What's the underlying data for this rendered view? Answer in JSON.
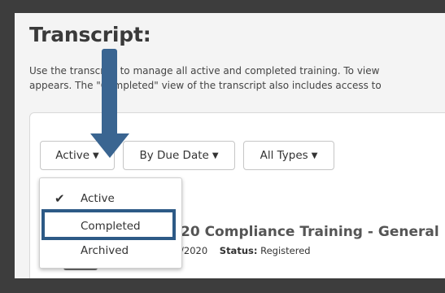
{
  "header": {
    "title": "Transcript:",
    "description_line1": "Use the transcript to manage all active and completed training. To view",
    "description_line2": "appears. The \"Completed\" view of the transcript also includes access to"
  },
  "filters": {
    "status_label": "Active",
    "sort_label": "By Due Date",
    "type_label": "All Types"
  },
  "status_menu": {
    "items": [
      {
        "label": "Active",
        "checked": true
      },
      {
        "label": "Completed",
        "highlighted": true
      },
      {
        "label": "Archived"
      }
    ]
  },
  "course": {
    "title_fragment": "20 Compliance Training - General",
    "date_fragment": "/2020",
    "status_label": "Status:",
    "status_value": "Registered"
  },
  "colors": {
    "highlight_border": "#2d5a86",
    "arrow": "#3a6591"
  }
}
